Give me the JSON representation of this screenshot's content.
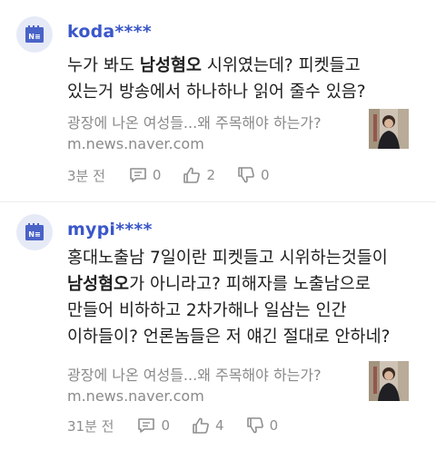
{
  "comments": [
    {
      "username": "koda****",
      "body_lines": [
        [
          {
            "t": "누가 봐도 ",
            "b": false
          },
          {
            "t": "남성혐오",
            "b": true
          },
          {
            "t": " 시위였는데? 피켓들고",
            "b": false
          }
        ],
        [
          {
            "t": "있는거 방송에서 하나하나 읽어 줄수 있음?",
            "b": false
          }
        ]
      ],
      "link_title": "광장에 나온 여성들...왜 주목해야 하는가?",
      "link_domain": "m.news.naver.com",
      "time": "3분 전",
      "replies": "0",
      "likes": "2",
      "dislikes": "0"
    },
    {
      "username": "mypi****",
      "body_lines": [
        [
          {
            "t": "홍대노출남 7일이란 피켓들고 시위하는것들이",
            "b": false
          }
        ],
        [
          {
            "t": "남성혐오",
            "b": true
          },
          {
            "t": "가 아니라고? 피해자를 노출남으로",
            "b": false
          }
        ],
        [
          {
            "t": "만들어 비하하고 2차가해나 일삼는 인간",
            "b": false
          }
        ],
        [
          {
            "t": "이하들이? 언론놈들은 저 얘긴 절대로 안하네?",
            "b": false
          }
        ]
      ],
      "link_title": "광장에 나온 여성들...왜 주목해야 하는가?",
      "link_domain": "m.news.naver.com",
      "time": "31분 전",
      "replies": "0",
      "likes": "4",
      "dislikes": "0"
    }
  ],
  "icons": {
    "avatar": "news-avatar-icon",
    "reply": "reply-icon",
    "like": "thumbs-up-icon",
    "dislike": "thumbs-down-icon"
  },
  "colors": {
    "username": "#3b57c9",
    "meta": "#8e8e8e",
    "avatar_bg": "#e6eaf7"
  }
}
